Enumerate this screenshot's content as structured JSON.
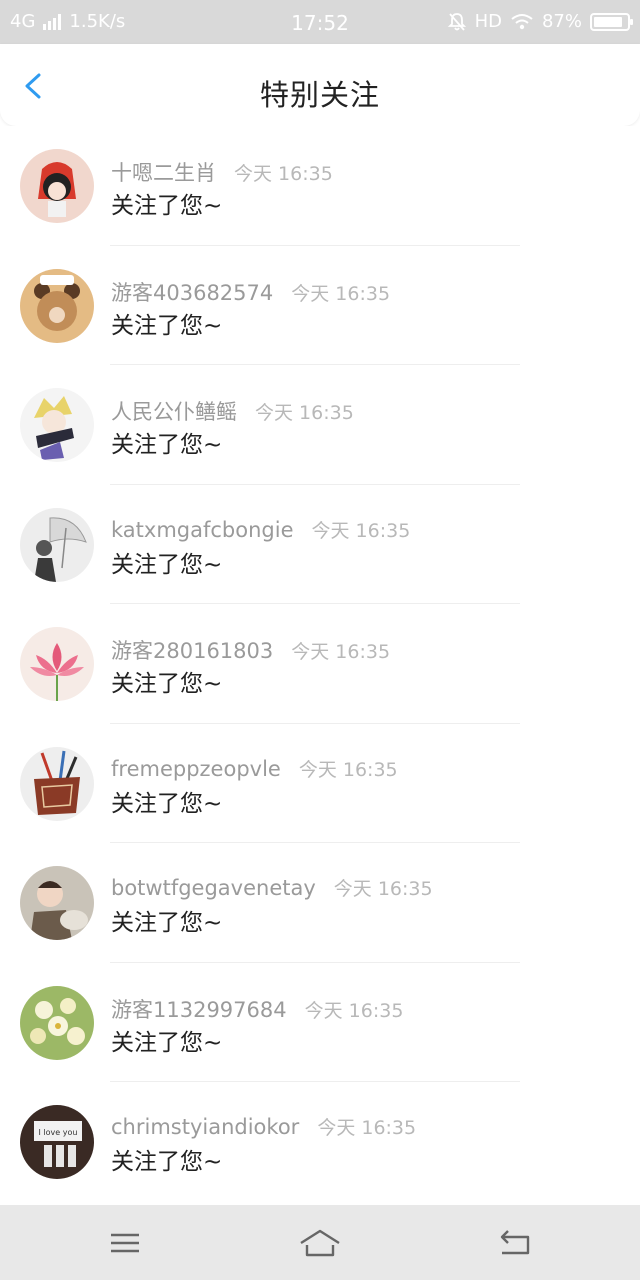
{
  "status_bar": {
    "network": "4G",
    "speed": "1.5K/s",
    "time": "17:52",
    "hd": "HD",
    "battery_text": "87%",
    "battery_level": 0.87,
    "icons": [
      "signal-icon",
      "mute-bell-icon",
      "wifi-icon",
      "battery-icon"
    ]
  },
  "header": {
    "title": "特别关注",
    "back_icon": "chevron-left-icon",
    "accent_color": "#2f9bf0"
  },
  "list": {
    "items": [
      {
        "name": "十嗯二生肖",
        "time": "今天 16:35",
        "message": "关注了您~",
        "avatar": "girl-red-hood"
      },
      {
        "name": "游客403682574",
        "time": "今天 16:35",
        "message": "关注了您~",
        "avatar": "bear-cartoon"
      },
      {
        "name": "人民公仆鳝鳐",
        "time": "今天 16:35",
        "message": "关注了您~",
        "avatar": "anime-boy"
      },
      {
        "name": "katxmgafcbongie",
        "time": "今天 16:35",
        "message": "关注了您~",
        "avatar": "umbrella-sketch"
      },
      {
        "name": "游客280161803",
        "time": "今天 16:35",
        "message": "关注了您~",
        "avatar": "lotus-flower"
      },
      {
        "name": "fremeppzeopvle",
        "time": "今天 16:35",
        "message": "关注了您~",
        "avatar": "pen-holder"
      },
      {
        "name": "botwtfgegavenetay",
        "time": "今天 16:35",
        "message": "关注了您~",
        "avatar": "child-photo"
      },
      {
        "name": "游客1132997684",
        "time": "今天 16:35",
        "message": "关注了您~",
        "avatar": "white-flowers"
      },
      {
        "name": "chrimstyiandiokor",
        "time": "今天 16:35",
        "message": "关注了您~",
        "avatar": "love-note",
        "avatar_text": "I love you"
      }
    ]
  },
  "bottom_bar": {
    "icons": [
      "menu-icon",
      "home-icon",
      "back-icon"
    ]
  }
}
